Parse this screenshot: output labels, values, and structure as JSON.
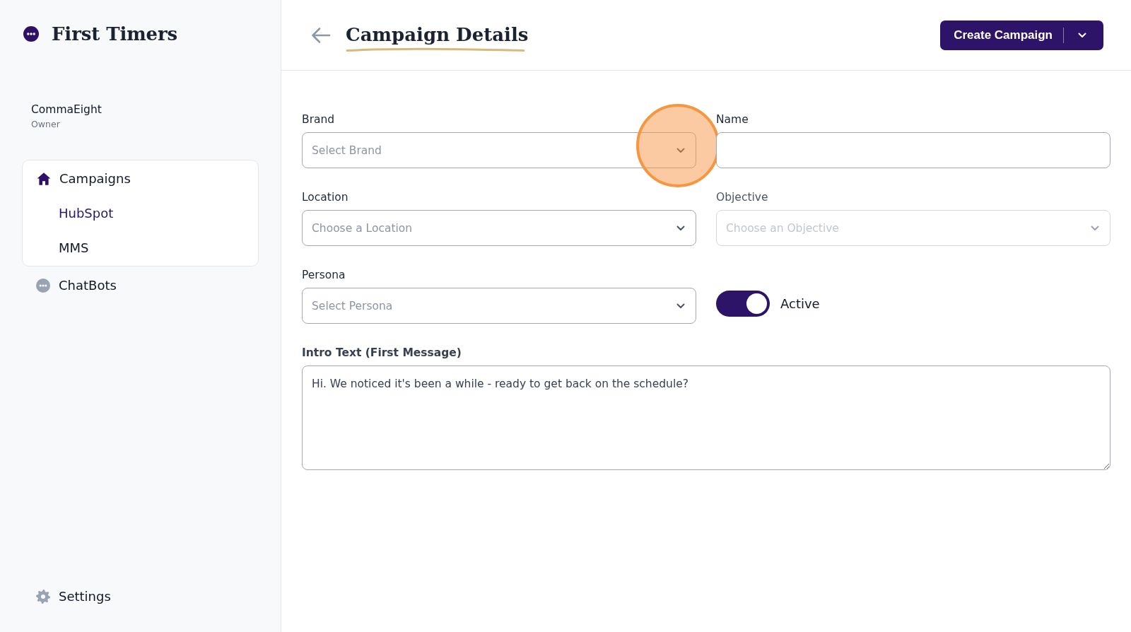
{
  "sidebar": {
    "brand": "First Timers",
    "account": {
      "name": "CommaEight",
      "role": "Owner"
    },
    "nav": [
      {
        "label": "Campaigns",
        "selected": true,
        "children": [
          {
            "label": "HubSpot",
            "selected": true
          },
          {
            "label": "MMS",
            "selected": false
          }
        ]
      },
      {
        "label": "ChatBots",
        "selected": false
      }
    ],
    "settings": {
      "label": "Settings"
    }
  },
  "header": {
    "title": "Campaign Details",
    "primary_button": {
      "label": "Create Campaign"
    }
  },
  "form": {
    "fields": [
      {
        "kind": "select",
        "label": "Brand",
        "placeholder": "Select Brand",
        "disabled": false,
        "highlighted": true
      },
      {
        "kind": "text",
        "label": "Name",
        "disabled": false,
        "highlighted": false
      },
      {
        "kind": "select",
        "label": "Location",
        "placeholder": "Choose a Location",
        "disabled": false,
        "highlighted": false
      },
      {
        "kind": "select",
        "label": "Objective",
        "placeholder": "Choose an Objective",
        "disabled": true,
        "highlighted": false
      },
      {
        "kind": "select",
        "label": "Persona",
        "placeholder": "Select Persona",
        "disabled": false,
        "highlighted": false
      },
      {
        "kind": "toggle",
        "label": "Active",
        "on": true,
        "highlighted": false
      },
      {
        "kind": "textarea",
        "label": "Intro Text (First Message)",
        "value": "Hi. We noticed it's been a while - ready to get back on the schedule?",
        "disabled": false,
        "highlighted": false
      }
    ]
  }
}
